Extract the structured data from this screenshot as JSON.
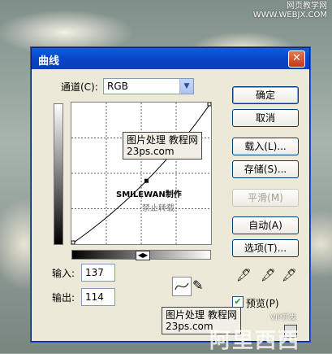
{
  "watermarks": {
    "top": "网页教学网\nWWW.WEBJX.COM",
    "box_line1": "图片处理",
    "box_line1b": "教程网",
    "box_line2": "23ps.com",
    "center": "SMILEWAN制作",
    "center_sub": "禁止转载",
    "bottom_small": "VIP开发",
    "bottom_big": "阿里西西"
  },
  "dialog": {
    "title": "曲线",
    "channel_label": "通道(C):",
    "channel_value": "RGB",
    "input_label": "输入:",
    "input_value": "137",
    "output_label": "输出:",
    "output_value": "114",
    "preview_label": "预览(P)",
    "preview_checked": true,
    "buttons": {
      "ok": "确定",
      "cancel": "取消",
      "load": "载入(L)...",
      "save": "存储(S)...",
      "smooth": "平滑(M)",
      "auto": "自动(A)",
      "options": "选项(T)..."
    },
    "curve_point": {
      "input": 137,
      "output": 114
    },
    "icons": [
      "close-icon",
      "curve-tool-icon",
      "pencil-icon",
      "black-eyedropper-icon",
      "gray-eyedropper-icon",
      "white-eyedropper-icon",
      "resize-icon"
    ]
  }
}
